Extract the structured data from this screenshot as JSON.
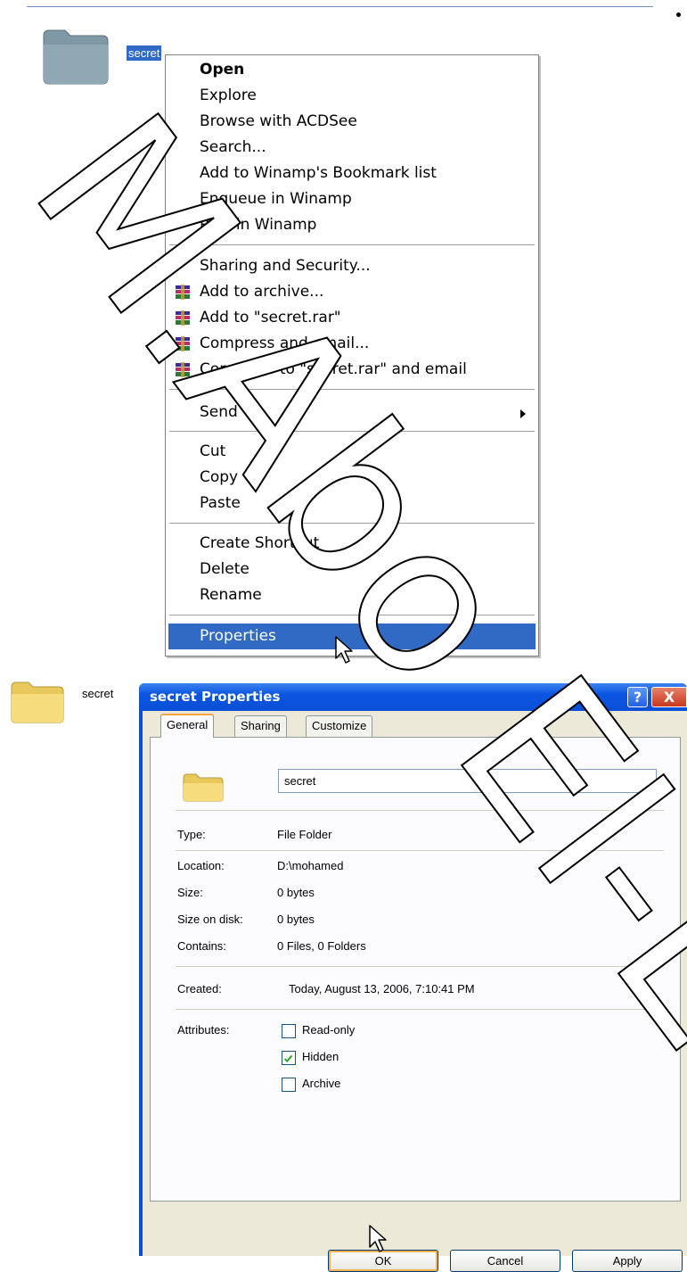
{
  "top": {
    "selected_label": "secret"
  },
  "context_menu": {
    "items": [
      {
        "label": "Open"
      },
      {
        "label": "Explore"
      },
      {
        "label": "Browse with ACDSee"
      },
      {
        "label": "Search..."
      },
      {
        "label": "Add to Winamp's Bookmark list"
      },
      {
        "label": "Enqueue in Winamp"
      },
      {
        "label": "Play in Winamp"
      },
      {
        "label": "Sharing and Security..."
      },
      {
        "label": "Add to archive..."
      },
      {
        "label": "Add to \"secret.rar\""
      },
      {
        "label": "Compress and email..."
      },
      {
        "label": "Compress to \"secret.rar\" and email"
      },
      {
        "label": "Send To"
      },
      {
        "label": "Cut"
      },
      {
        "label": "Copy"
      },
      {
        "label": "Paste"
      },
      {
        "label": "Create Shortcut"
      },
      {
        "label": "Delete"
      },
      {
        "label": "Rename"
      },
      {
        "label": "Properties"
      }
    ],
    "highlighted": "Properties"
  },
  "bottom": {
    "folder_label": "secret"
  },
  "dialog": {
    "title": "secret Properties",
    "help_glyph": "?",
    "close_glyph": "X",
    "tabs": [
      "General",
      "Sharing",
      "Customize"
    ],
    "active_tab": "General",
    "name_value": "secret",
    "props": {
      "type_label": "Type:",
      "type_value": "File Folder",
      "location_label": "Location:",
      "location_value": "D:\\mohamed",
      "size_label": "Size:",
      "size_value": "0 bytes",
      "size_on_disk_label": "Size on disk:",
      "size_on_disk_value": "0 bytes",
      "contains_label": "Contains:",
      "contains_value": "0 Files, 0 Folders",
      "created_label": "Created:",
      "created_value": "Today, August 13, 2006, 7:10:41 PM",
      "attributes_label": "Attributes:"
    },
    "attributes": [
      {
        "label": "Read-only",
        "checked": false
      },
      {
        "label": "Hidden",
        "checked": true
      },
      {
        "label": "Archive",
        "checked": false
      }
    ],
    "buttons": {
      "ok": "OK",
      "cancel": "Cancel",
      "apply": "Apply"
    }
  },
  "watermark": {
    "text": "M.Abo El-E"
  },
  "colors": {
    "selection": "#316ac5",
    "xp_title": "#0a4fd6",
    "dialog_face": "#ece9d8"
  }
}
